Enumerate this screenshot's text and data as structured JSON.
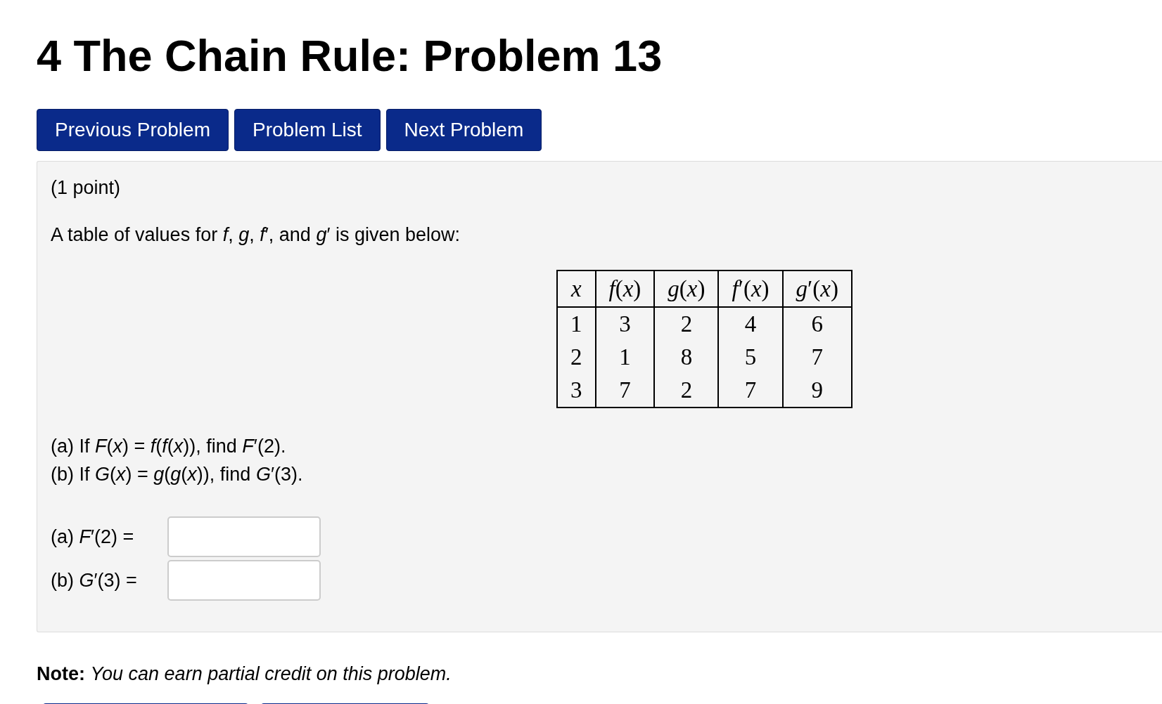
{
  "title": "4 The Chain Rule: Problem 13",
  "nav_buttons": [
    "Previous Problem",
    "Problem List",
    "Next Problem"
  ],
  "problem": {
    "points": "(1 point)",
    "intro": "A table of values for *f*, *g*, *f*′, and *g*′  is given below:",
    "table": {
      "columns": [
        "*x*",
        "*f*(*x*)",
        "*g*(*x*)",
        "*f*′(*x*)",
        "*g*′(*x*)"
      ],
      "rows": [
        [
          "1",
          "3",
          "2",
          "4",
          "6"
        ],
        [
          "2",
          "1",
          "8",
          "5",
          "7"
        ],
        [
          "3",
          "7",
          "2",
          "7",
          "9"
        ]
      ]
    },
    "questions": [
      "(a) If *F*(*x*) = *f*(*f*(*x*)), find *F*′(2).",
      "(b) If *G*(*x*) = *g*(*g*(*x*)), find *G*′(3)."
    ],
    "answers": [
      {
        "label": "(a) *F*′(2) ="
      },
      {
        "label": "(b) *G*′(3) ="
      }
    ]
  },
  "note": "**Note:** *You can earn partial credit on this problem.*"
}
